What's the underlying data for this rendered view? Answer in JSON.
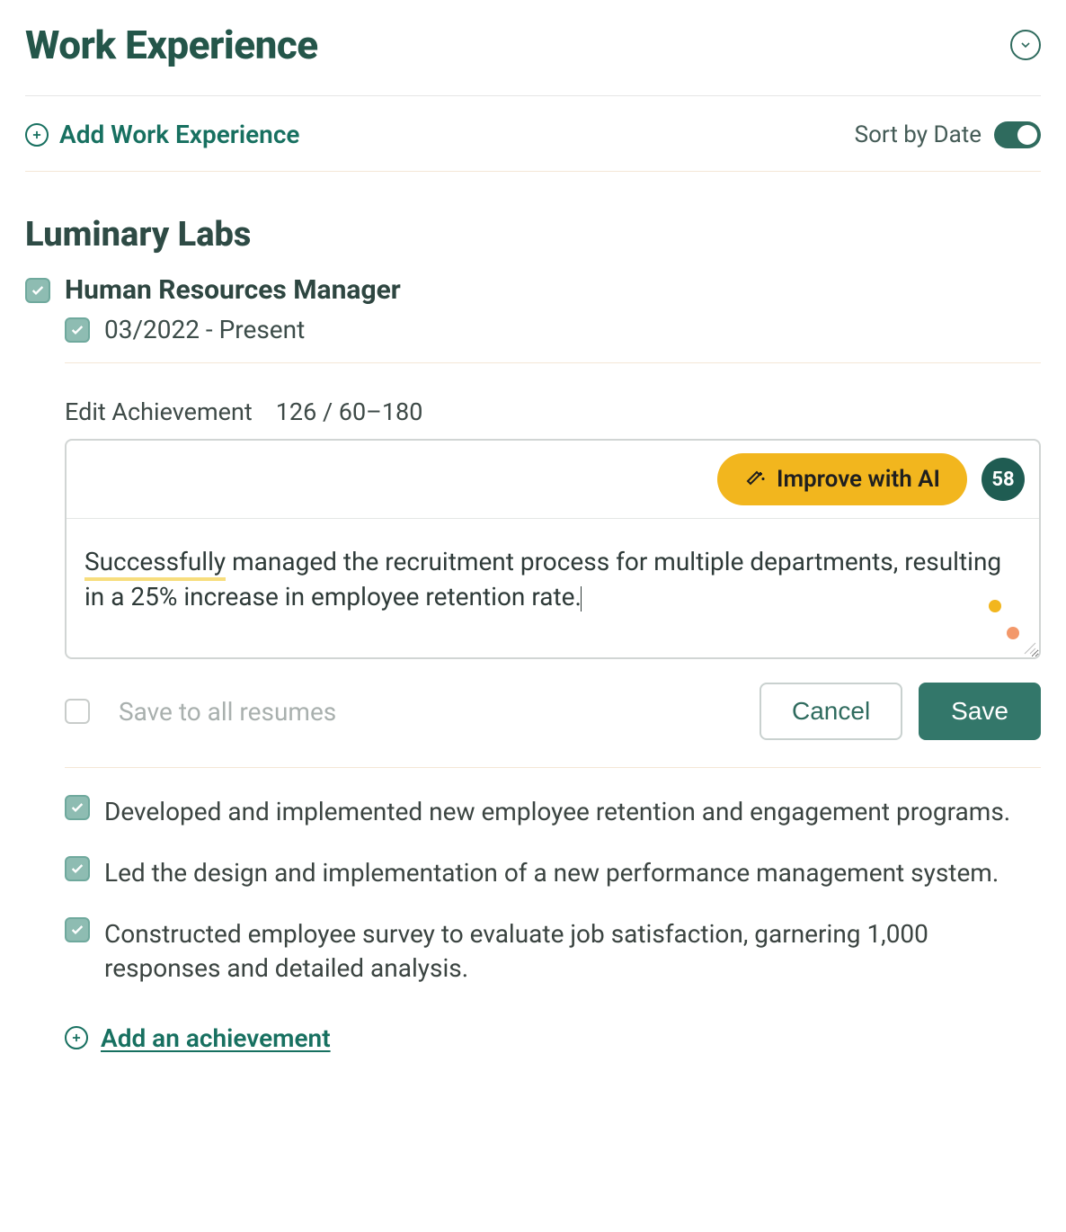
{
  "section": {
    "title": "Work Experience",
    "add_label": "Add Work Experience",
    "sort_label": "Sort by Date"
  },
  "company": {
    "name": "Luminary Labs",
    "job_title": "Human Resources Manager",
    "date_range": "03/2022 - Present"
  },
  "editor": {
    "label": "Edit Achievement",
    "char_count": "126 / 60–180",
    "improve_label": "Improve with AI",
    "score": "58",
    "highlight_word": "Successfully",
    "text_rest": " managed the recruitment process for multiple departments, resulting in a 25% increase in employee retention rate."
  },
  "actions": {
    "save_all_label": "Save to all resumes",
    "cancel": "Cancel",
    "save": "Save"
  },
  "achievements": [
    "Developed and implemented new employee retention and engagement programs.",
    "Led the design and implementation of a new performance management system.",
    "Constructed employee survey to evaluate job satisfaction, garnering 1,000 responses and detailed analysis."
  ],
  "add_achievement_label": "Add an achievement"
}
